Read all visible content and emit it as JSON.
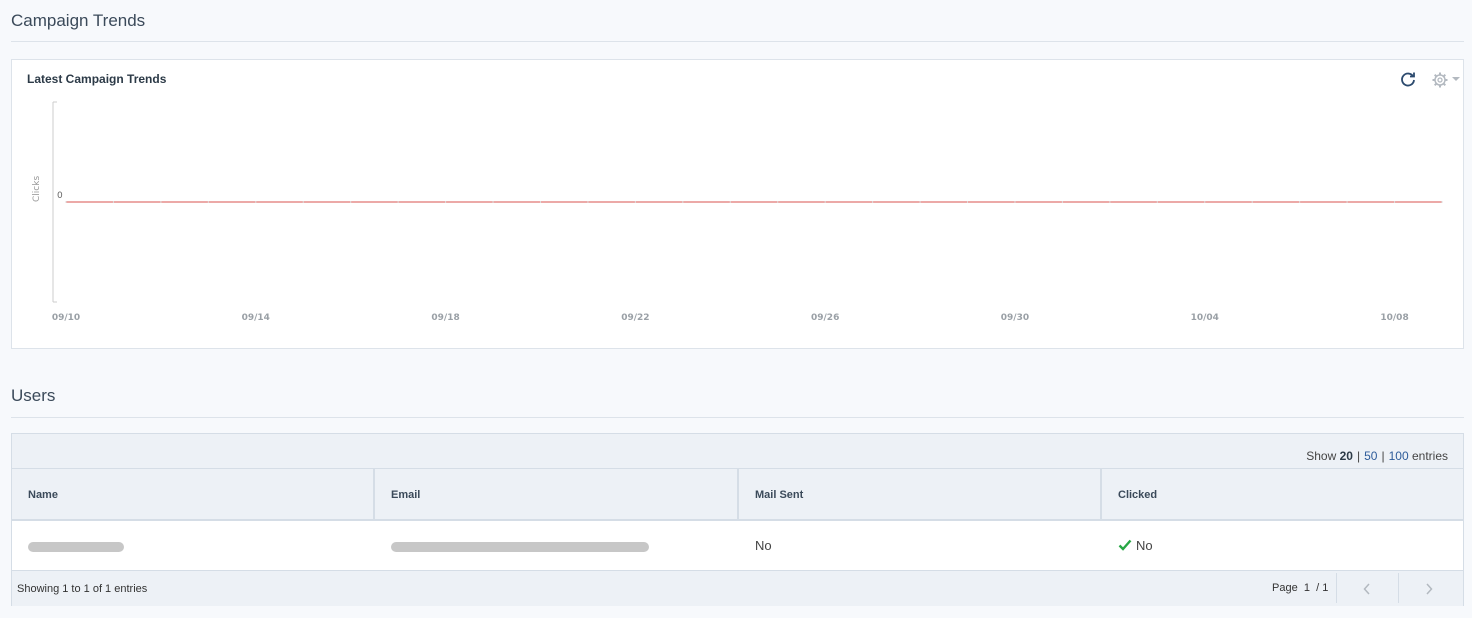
{
  "sections": {
    "campaign_trends": "Campaign Trends",
    "users": "Users"
  },
  "chart_panel": {
    "title": "Latest Campaign Trends",
    "refresh_icon": "refresh-icon",
    "settings_icon": "gear-icon"
  },
  "chart_data": {
    "type": "line",
    "title": "Latest Campaign Trends",
    "xlabel": "",
    "ylabel": "Clicks",
    "x_ticks": [
      "09/10",
      "09/14",
      "09/18",
      "09/22",
      "09/26",
      "09/30",
      "10/04",
      "10/08"
    ],
    "y_ticks": [
      "0"
    ],
    "x": [
      "09/10",
      "09/11",
      "09/12",
      "09/13",
      "09/14",
      "09/15",
      "09/16",
      "09/17",
      "09/18",
      "09/19",
      "09/20",
      "09/21",
      "09/22",
      "09/23",
      "09/24",
      "09/25",
      "09/26",
      "09/27",
      "09/28",
      "09/29",
      "09/30",
      "10/01",
      "10/02",
      "10/03",
      "10/04",
      "10/05",
      "10/06",
      "10/07",
      "10/08",
      "10/09"
    ],
    "series": [
      {
        "color": "#d9534f",
        "values": [
          0,
          0,
          0,
          0,
          0,
          0,
          0,
          0,
          0,
          0,
          0,
          0,
          0,
          0,
          0,
          0,
          0,
          0,
          0,
          0,
          0,
          0,
          0,
          0,
          0,
          0,
          0,
          0,
          0,
          0
        ]
      }
    ],
    "grid": false
  },
  "users_table": {
    "show_label": "Show",
    "page_sizes": [
      "20",
      "50",
      "100"
    ],
    "active_page_size": "20",
    "entries_label": "entries",
    "columns": [
      "Name",
      "Email",
      "Mail Sent",
      "Clicked"
    ],
    "rows": [
      {
        "name": "",
        "email": "",
        "mail_sent": "No",
        "clicked": "No"
      }
    ],
    "footer_info": "Showing 1 to 1 of 1 entries",
    "page_label": "Page",
    "page_current": "1",
    "page_total": "/ 1"
  },
  "colors": {
    "accent": "#2e5c9a",
    "check": "#28a745",
    "line": "#d9534f"
  }
}
